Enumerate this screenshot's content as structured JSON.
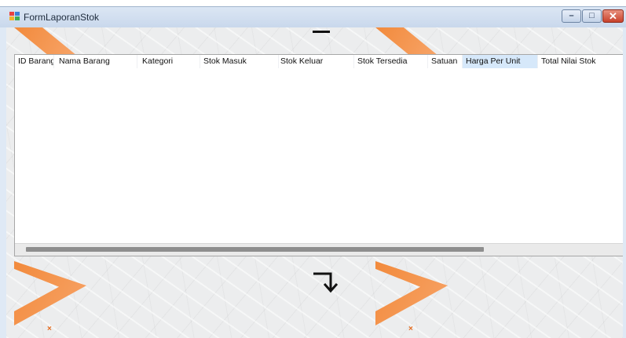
{
  "window": {
    "title": "FormLaporanStok",
    "controls": {
      "minimize": "–",
      "maximize": "□",
      "close": "✕"
    }
  },
  "grid": {
    "columns": [
      {
        "label": "ID Barang",
        "selected": false
      },
      {
        "label": "Nama Barang",
        "selected": false
      },
      {
        "label": "Kategori",
        "selected": false
      },
      {
        "label": "Stok Masuk",
        "selected": false
      },
      {
        "label": "Stok Keluar",
        "selected": false
      },
      {
        "label": "Stok Tersedia",
        "selected": false
      },
      {
        "label": "Satuan",
        "selected": false
      },
      {
        "label": "Harga Per Unit",
        "selected": true
      },
      {
        "label": "Total Nilai Stok",
        "selected": false
      }
    ],
    "rows": [],
    "horizontal_scroll_position": 0
  },
  "decor": {
    "marks": [
      "×",
      "×"
    ],
    "colors": {
      "accent": "#f28a3c",
      "selected_header": "#d6e8fa",
      "close": "#c8412b"
    }
  }
}
